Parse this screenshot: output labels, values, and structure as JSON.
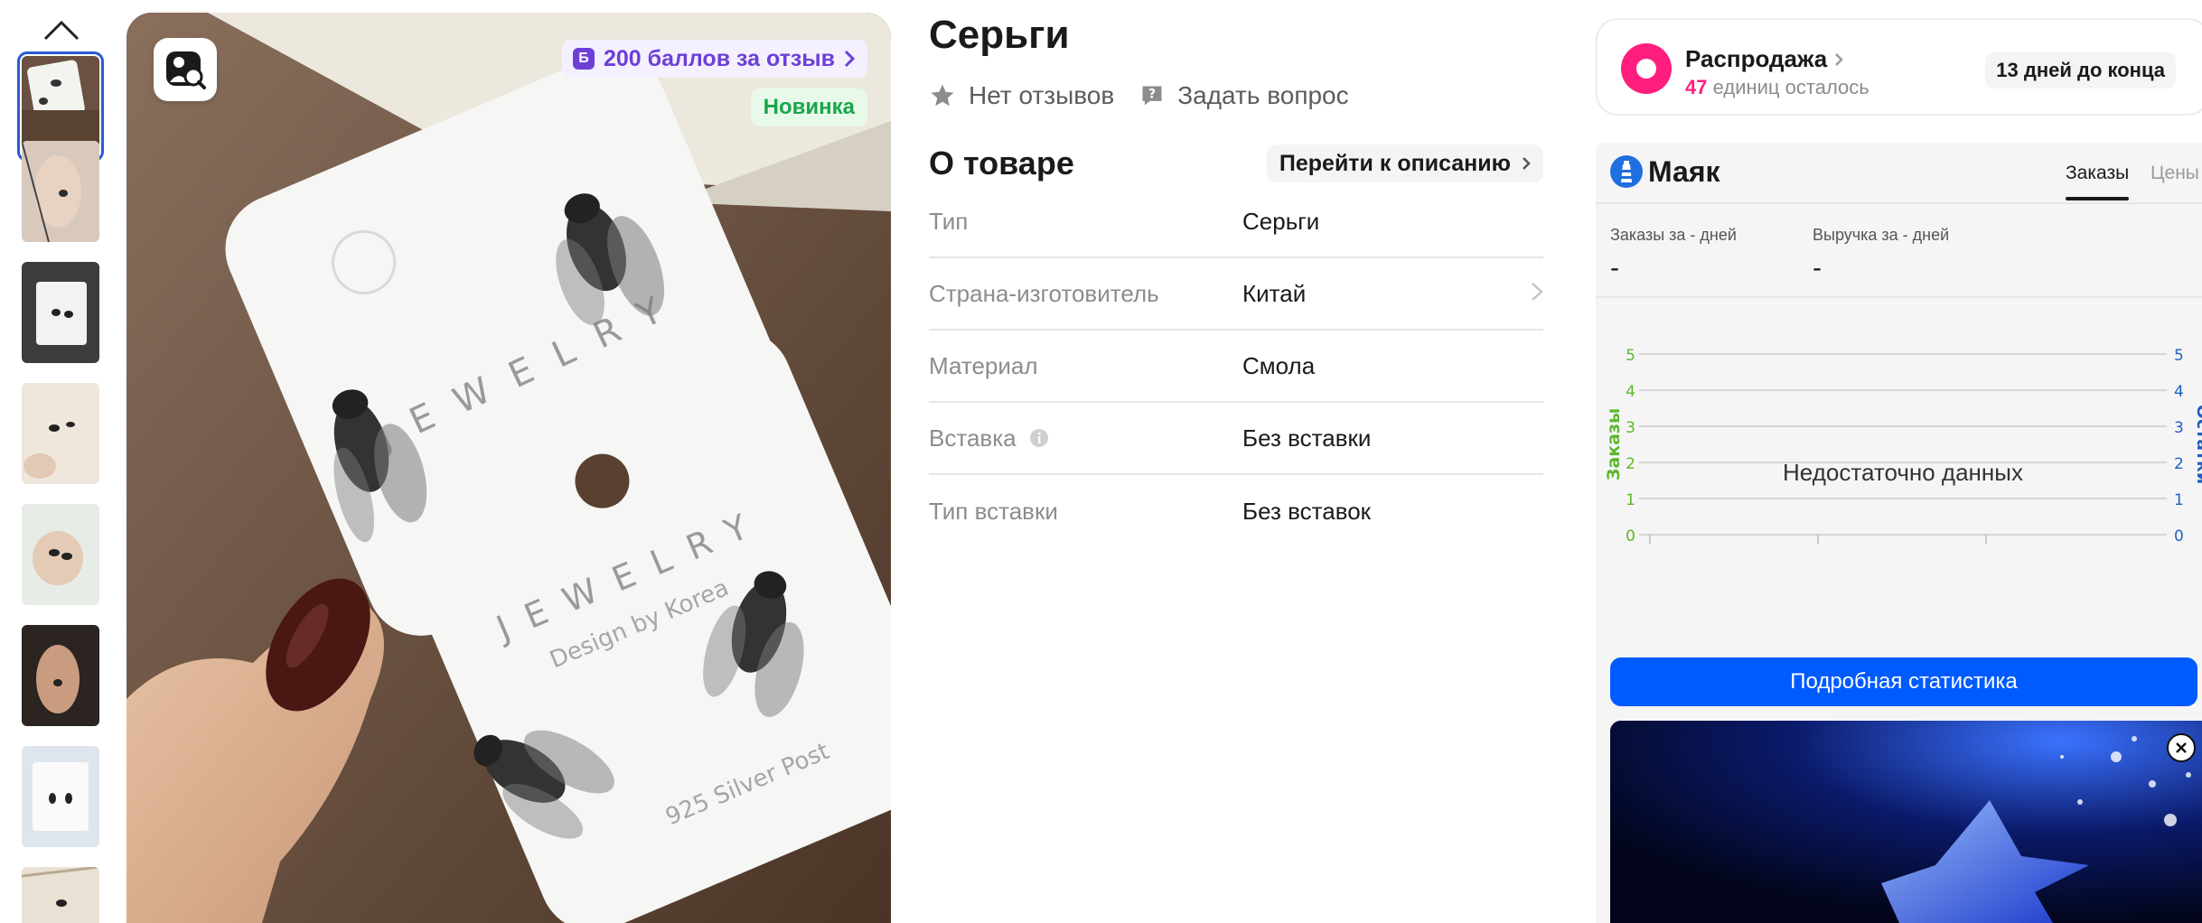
{
  "product": {
    "title": "Серьги",
    "reviews_label": "Нет отзывов",
    "ask_label": "Задать вопрос"
  },
  "photo": {
    "bonus_badge_letter": "Б",
    "bonus_badge": "200 баллов за отзыв",
    "new_badge": "Новинка"
  },
  "about": {
    "title": "О товаре",
    "goto_description": "Перейти к описанию",
    "specs": [
      {
        "label": "Тип",
        "value": "Серьги"
      },
      {
        "label": "Страна-изготовитель",
        "value": "Китай"
      },
      {
        "label": "Материал",
        "value": "Смола"
      },
      {
        "label": "Вставка",
        "value": "Без вставки"
      },
      {
        "label": "Тип вставки",
        "value": "Без вставок"
      }
    ]
  },
  "sale": {
    "title": "Распродажа",
    "units_count": "47",
    "units_text": "единиц осталось",
    "days_left": "13 дней до конца"
  },
  "mayak": {
    "name": "Маяк",
    "tabs": [
      "Заказы",
      "Цены"
    ],
    "orders_label": "Заказы за - дней",
    "orders_value": "-",
    "revenue_label": "Выручка за - дней",
    "revenue_value": "-",
    "no_data": "Недостаточно данных",
    "details_button": "Подробная статистика"
  },
  "chart_data": {
    "type": "line",
    "left_axis_label": "Заказы",
    "right_axis_label": "Остатки",
    "left_ticks": [
      "0",
      "1",
      "2",
      "3",
      "4",
      "5"
    ],
    "right_ticks": [
      "0",
      "1",
      "2",
      "3",
      "4",
      "5"
    ],
    "ylim": [
      0,
      5
    ],
    "series": [],
    "left_color": "#5cb82c",
    "right_color": "#1f5fc4"
  },
  "colors": {
    "accent_blue": "#005bff",
    "sale_pink": "#ff1e7e",
    "bonus_purple": "#6d3fd6",
    "new_green": "#19a64a"
  },
  "icons": {
    "thumb_up": "chevron-up-icon",
    "lens": "image-search-icon",
    "reviews": "star-icon",
    "ask": "question-bubble-icon",
    "info": "info-icon",
    "promo_close": "close-icon"
  }
}
